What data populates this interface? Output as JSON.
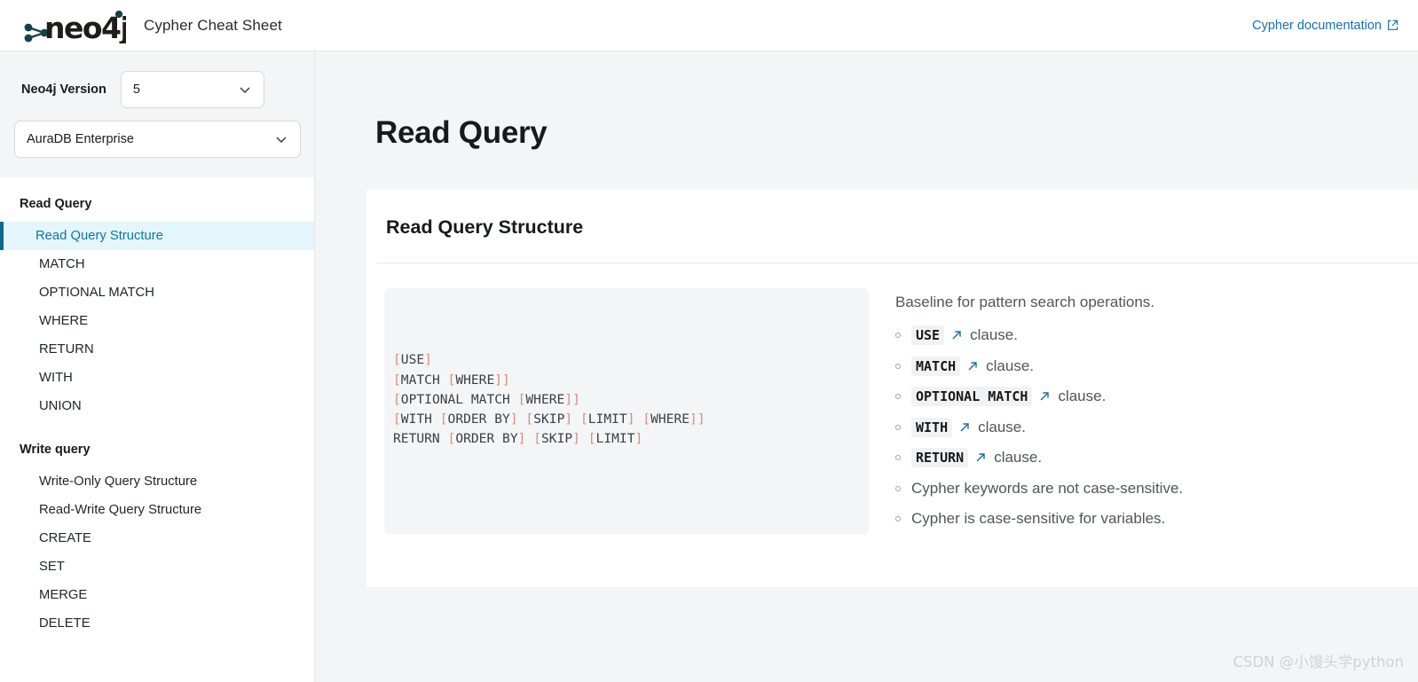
{
  "header": {
    "logo_text": "neo4j",
    "logo_icon": "neo4j-graph-logo",
    "app_title": "Cypher Cheat Sheet",
    "doc_link_label": "Cypher documentation",
    "doc_link_icon": "external-link-icon"
  },
  "sidebar": {
    "version_label": "Neo4j Version",
    "version_value": "5",
    "edition_value": "AuraDB Enterprise",
    "chevron_icon": "chevron-down-icon",
    "groups": [
      {
        "title": "Read Query",
        "items": [
          {
            "label": "Read Query Structure",
            "active": true
          },
          {
            "label": "MATCH",
            "active": false
          },
          {
            "label": "OPTIONAL MATCH",
            "active": false
          },
          {
            "label": "WHERE",
            "active": false
          },
          {
            "label": "RETURN",
            "active": false
          },
          {
            "label": "WITH",
            "active": false
          },
          {
            "label": "UNION",
            "active": false
          }
        ]
      },
      {
        "title": "Write query",
        "items": [
          {
            "label": "Write-Only Query Structure",
            "active": false
          },
          {
            "label": "Read-Write Query Structure",
            "active": false
          },
          {
            "label": "CREATE",
            "active": false
          },
          {
            "label": "SET",
            "active": false
          },
          {
            "label": "MERGE",
            "active": false
          },
          {
            "label": "DELETE",
            "active": false
          }
        ]
      }
    ]
  },
  "main": {
    "page_title": "Read Query",
    "card": {
      "heading": "Read Query Structure",
      "code_lines": [
        "[USE]",
        "[MATCH [WHERE]]",
        "[OPTIONAL MATCH [WHERE]]",
        "[WITH [ORDER BY] [SKIP] [LIMIT] [WHERE]]",
        "RETURN [ORDER BY] [SKIP] [LIMIT]"
      ],
      "notes_intro": "Baseline for pattern search operations.",
      "notes": [
        {
          "keyword": "USE",
          "link": true,
          "text": "clause."
        },
        {
          "keyword": "MATCH",
          "link": true,
          "text": "clause."
        },
        {
          "keyword": "OPTIONAL MATCH",
          "link": true,
          "text": "clause."
        },
        {
          "keyword": "WITH",
          "link": true,
          "text": "clause."
        },
        {
          "keyword": "RETURN",
          "link": true,
          "text": "clause."
        },
        {
          "keyword": "",
          "link": false,
          "text": "Cypher keywords are not case-sensitive."
        },
        {
          "keyword": "",
          "link": false,
          "text": "Cypher is case-sensitive for variables."
        }
      ],
      "link_icon": "arrow-up-right-icon"
    }
  },
  "watermark": "CSDN @小馒头学python",
  "colors": {
    "accent_blue": "#1a6ea8",
    "active_bar": "#0e6a8c",
    "active_bg": "#e4f6fb",
    "page_bg": "#f4f5f6",
    "bracket": "#d98b7f"
  }
}
